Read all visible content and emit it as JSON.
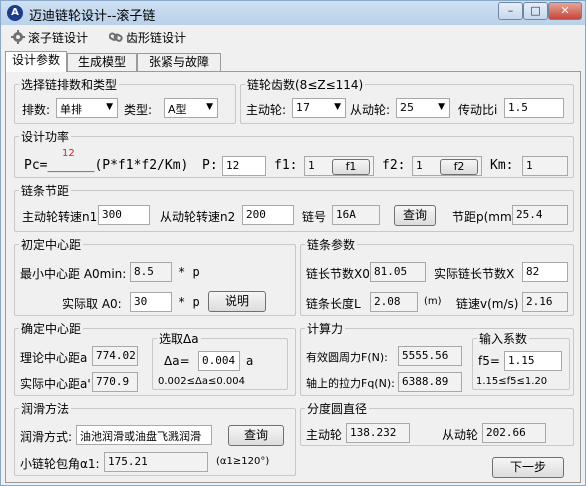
{
  "window": {
    "title": "迈迪链轮设计--滚子链",
    "controls": [
      "minimize-icon",
      "maximize-icon",
      "close-icon"
    ]
  },
  "menu": [
    {
      "label": "滚子链设计",
      "icon": "gear-icon"
    },
    {
      "label": "齿形链设计",
      "icon": "chain-icon"
    }
  ],
  "tabs": [
    "设计参数",
    "生成模型",
    "张紧与故障"
  ],
  "select_chain": {
    "legend": "选择链排数和类型",
    "rows_label": "排数:",
    "rows_value": "单排",
    "type_label": "类型:",
    "type_value": "A型"
  },
  "teeth": {
    "legend": "链轮齿数(8≤Z≤114)",
    "driver_label": "主动轮:",
    "driver_value": "17",
    "driven_label": "从动轮:",
    "driven_value": "25",
    "ratio_label": "传动比i",
    "ratio_value": "1.5"
  },
  "power": {
    "legend": "设计功率",
    "marker": "12",
    "formula": "Pc=______(P*f1*f2/Km)",
    "p_label": "P:",
    "p_value": "12",
    "f1_label": "f1:",
    "f1_value": "1",
    "f1_button": "f1",
    "f2_label": "f2:",
    "f2_value": "1",
    "f2_button": "f2",
    "km_label": "Km:",
    "km_value": "1"
  },
  "pitch": {
    "legend": "链条节距",
    "n1_label": "主动轮转速n1",
    "n1_value": "300",
    "n2_label": "从动轮转速n2",
    "n2_value": "200",
    "chain_no_label": "链号",
    "chain_no_value": "16A",
    "query_button": "查询",
    "pitch_label": "节距p(mm)",
    "pitch_value": "25.4"
  },
  "initial_center": {
    "legend": "初定中心距",
    "min_label": "最小中心距 A0min:",
    "min_value": "8.5",
    "min_unit": "* p",
    "actual_label": "实际取 A0:",
    "actual_value": "30",
    "actual_unit": "* p",
    "explain_button": "说明"
  },
  "chain_params": {
    "legend": "链条参数",
    "x0_label": "链长节数X0",
    "x0_value": "81.05",
    "x_label": "实际链长节数X",
    "x_value": "82",
    "l_label": "链条长度L",
    "l_value": "2.08",
    "l_unit": "(m)",
    "v_label": "链速v(m/s)",
    "v_value": "2.16"
  },
  "confirm_center": {
    "legend": "确定中心距",
    "theory_label": "理论中心距a",
    "theory_value": "774.02",
    "actual_label": "实际中心距a'",
    "actual_value": "770.9",
    "delta_legend": "选取Δa",
    "delta_label": "Δa=",
    "delta_value": "0.004",
    "delta_unit": "a",
    "delta_range": "0.002≤Δa≤0.004"
  },
  "force": {
    "legend": "计算力",
    "f_label": "有效圆周力F(N):",
    "f_value": "5555.56",
    "fq_label": "轴上的拉力Fq(N):",
    "fq_value": "6388.89",
    "coef_legend": "输入系数",
    "f5_label": "f5=",
    "f5_value": "1.15",
    "f5_range": "1.15≤f5≤1.20"
  },
  "lubrication": {
    "legend": "润滑方法",
    "method_label": "润滑方式:",
    "method_value": "油池润滑或油盘飞溅润滑",
    "query_button": "查询",
    "angle_label": "小链轮包角α1:",
    "angle_value": "175.21",
    "angle_note": "(α1≥120°)"
  },
  "pitch_circle": {
    "legend": "分度圆直径",
    "driver_label": "主动轮",
    "driver_value": "138.232",
    "driven_label": "从动轮",
    "driven_value": "202.66"
  },
  "next_button": "下一步"
}
